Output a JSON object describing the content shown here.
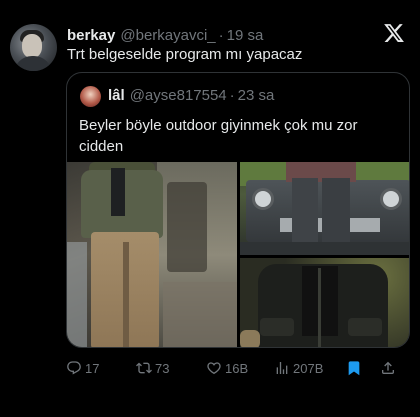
{
  "tweet": {
    "author_name": "berkay",
    "author_handle": "@berkayavci_",
    "separator": "·",
    "time": "19 sa",
    "text": "Trt belgeselde program mı yapacaz"
  },
  "quote": {
    "author_name": "lâl",
    "author_handle": "@ayse817554",
    "separator": "·",
    "time": "23 sa",
    "text": "Beyler böyle outdoor giyinmek çok mu zor cidden"
  },
  "actions": {
    "replies": "17",
    "reposts": "73",
    "likes": "16B",
    "views": "207B"
  },
  "icons": {
    "logo": "x-logo-icon",
    "reply": "reply-icon",
    "repost": "repost-icon",
    "like": "heart-icon",
    "views": "views-icon",
    "bookmark": "bookmark-icon",
    "share": "share-icon"
  },
  "colors": {
    "background": "#000000",
    "text": "#e7e9ea",
    "muted": "#71767b",
    "border": "#2f3336",
    "bookmark": "#1d9bf0"
  }
}
